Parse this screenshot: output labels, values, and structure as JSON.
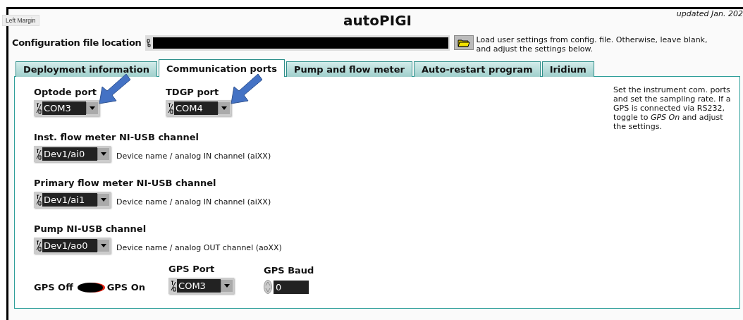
{
  "tooltip": "Left Margin",
  "title": "autoPIGI",
  "updated": "updated Jan. 202",
  "config": {
    "label": "Configuration file location",
    "hint": "Load user settings from config. file. Otherwise, leave blank, and adjust the settings below."
  },
  "tabs": [
    {
      "label": "Deployment information",
      "selected": false
    },
    {
      "label": "Communication ports",
      "selected": true
    },
    {
      "label": "Pump and flow meter",
      "selected": false
    },
    {
      "label": "Auto-restart program",
      "selected": false
    },
    {
      "label": "Iridium",
      "selected": false
    }
  ],
  "ports": [
    {
      "label": "Optode port",
      "value": "COM3"
    },
    {
      "label": "TDGP port",
      "value": "COM4"
    }
  ],
  "channels": [
    {
      "label": "Inst. flow meter NI-USB channel",
      "value": "Dev1/ai0",
      "description": "Device name / analog IN channel (aiXX)"
    },
    {
      "label": "Primary flow meter NI-USB channel",
      "value": "Dev1/ai1",
      "description": "Device name / analog IN channel (aiXX)"
    },
    {
      "label": "Pump NI-USB channel",
      "value": "Dev1/ao0",
      "description": "Device name / analog OUT channel (aoXX)"
    }
  ],
  "gps": {
    "off_label": "GPS Off",
    "on_label": "GPS On",
    "on": false,
    "port_label": "GPS Port",
    "port": "COM3",
    "baud_label": "GPS Baud",
    "baud": "0"
  },
  "help": "Set the instrument com. ports and set the sampling rate. If a GPS is connected via RS232, toggle to *GPS On* and adjust the settings."
}
